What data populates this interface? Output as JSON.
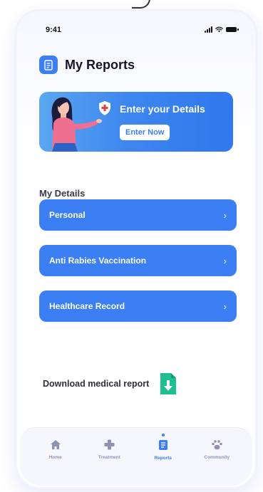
{
  "status_bar": {
    "time": "9:41"
  },
  "header": {
    "title": "My Reports",
    "icon": "report-icon"
  },
  "banner": {
    "title": "Enter your Details",
    "button_label": "Enter Now",
    "icon": "medical-shield-icon"
  },
  "details": {
    "title": "My Details",
    "items": [
      {
        "label": "Personal"
      },
      {
        "label": "Anti Rabies Vaccination"
      },
      {
        "label": "Healthcare Record"
      }
    ]
  },
  "download": {
    "label": "Download medical report",
    "icon": "download-file-icon"
  },
  "nav": {
    "items": [
      {
        "label": "Home",
        "icon": "home-icon"
      },
      {
        "label": "Treatment",
        "icon": "plus-icon"
      },
      {
        "label": "Reports",
        "icon": "reports-icon"
      },
      {
        "label": "Community",
        "icon": "paw-icon"
      }
    ],
    "active_item": "Reports"
  },
  "colors": {
    "accent": "#3c7ef3",
    "download_icon": "#1fbf8f",
    "nav_inactive": "#8d93b5"
  }
}
